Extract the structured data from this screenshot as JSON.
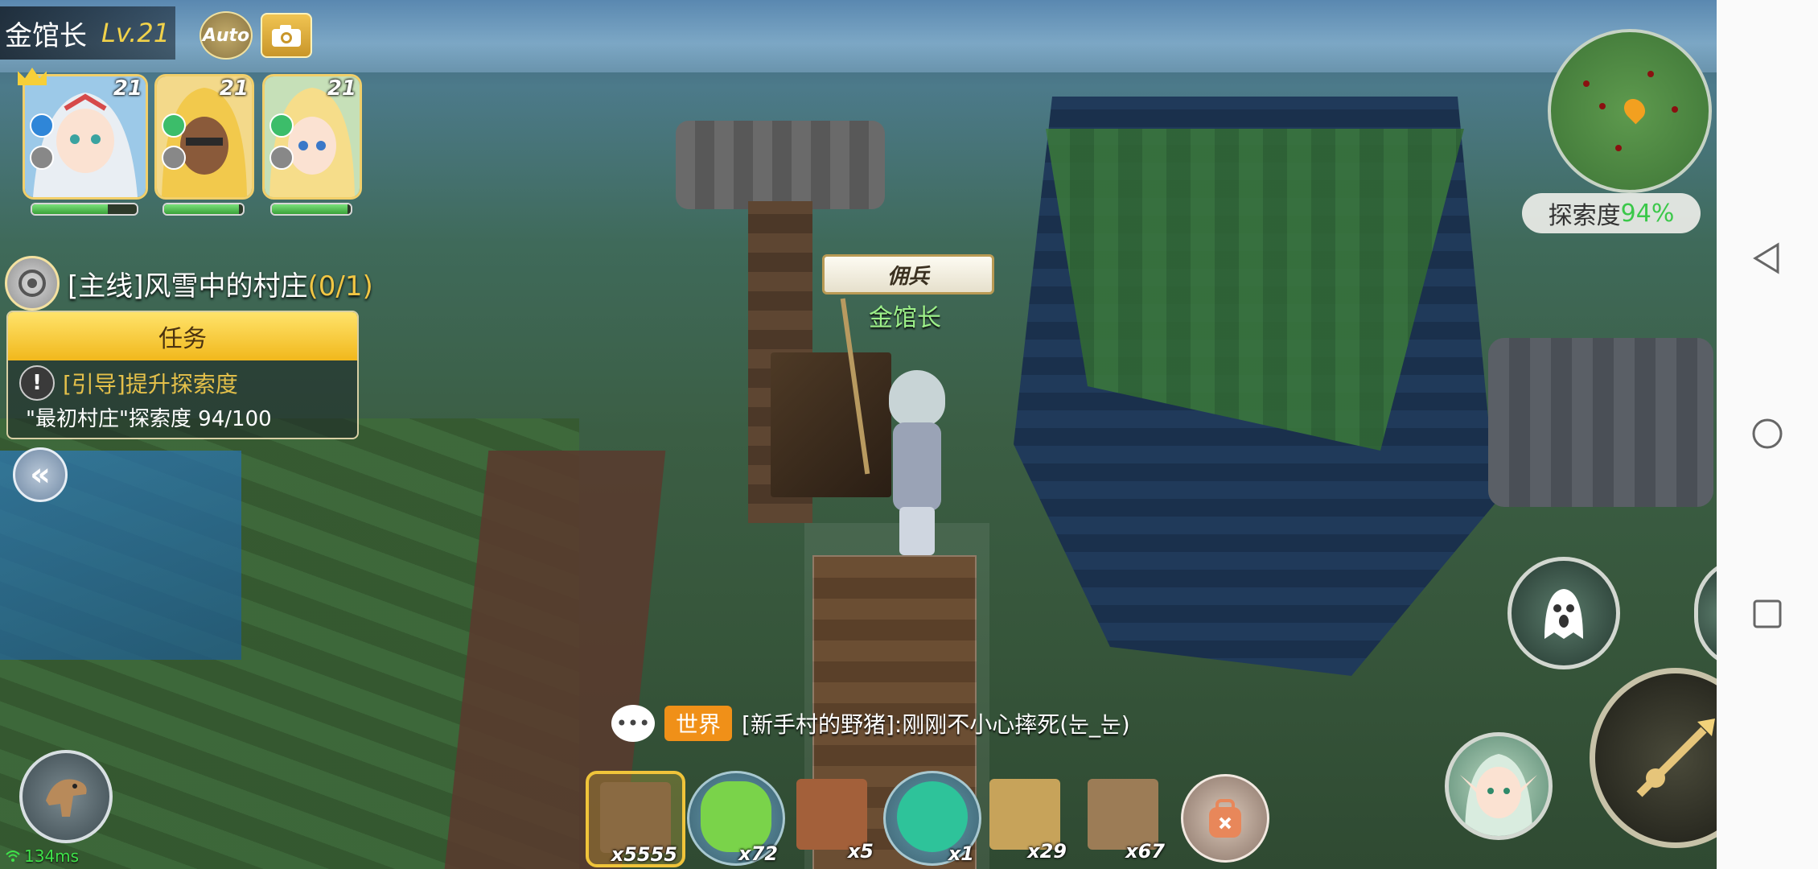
{
  "header": {
    "player_name": "金馆长",
    "level": "Lv.21",
    "auto_label": "Auto",
    "camera_icon": "camera-icon"
  },
  "party": [
    {
      "level": "21",
      "element": "water",
      "hp": 0.72,
      "leader": true
    },
    {
      "level": "21",
      "element": "wind",
      "hp": 0.95,
      "leader": false
    },
    {
      "level": "21",
      "element": "wind",
      "hp": 0.96,
      "leader": false
    }
  ],
  "quest": {
    "title": "[主线]风雪中的村庄",
    "progress": "(0/1)",
    "panel_header": "任务",
    "guide_text": "[引导]提升探索度",
    "detail_text": "\"最初村庄\"探索度 94/100"
  },
  "world": {
    "npc_title": "佣兵",
    "npc_name": "金馆长"
  },
  "minimap": {
    "explore_label": "探索度",
    "explore_value": "94%"
  },
  "chat": {
    "channel": "世界",
    "message": "[新手村的野猪]:刚刚不小心摔死(눈_눈)"
  },
  "hotbar": [
    {
      "item": "wood-block",
      "count": "x5555",
      "selected": true,
      "color": "#8a6a42"
    },
    {
      "item": "green-potion",
      "count": "x72",
      "selected": false,
      "color": "#7ad34a"
    },
    {
      "item": "cracked-brick",
      "count": "x5",
      "selected": false,
      "color": "#a3603a"
    },
    {
      "item": "teal-potion",
      "count": "x1",
      "selected": false,
      "color": "#2ec39a"
    },
    {
      "item": "sand-block",
      "count": "x29",
      "selected": false,
      "color": "#c7a35a"
    },
    {
      "item": "plank-block",
      "count": "x67",
      "selected": false,
      "color": "#9c7c56"
    }
  ],
  "status": {
    "ping": "134ms"
  },
  "colors": {
    "accent_gold": "#f1c644",
    "explore_green": "#3bc84a",
    "chat_channel": "#f09018"
  }
}
